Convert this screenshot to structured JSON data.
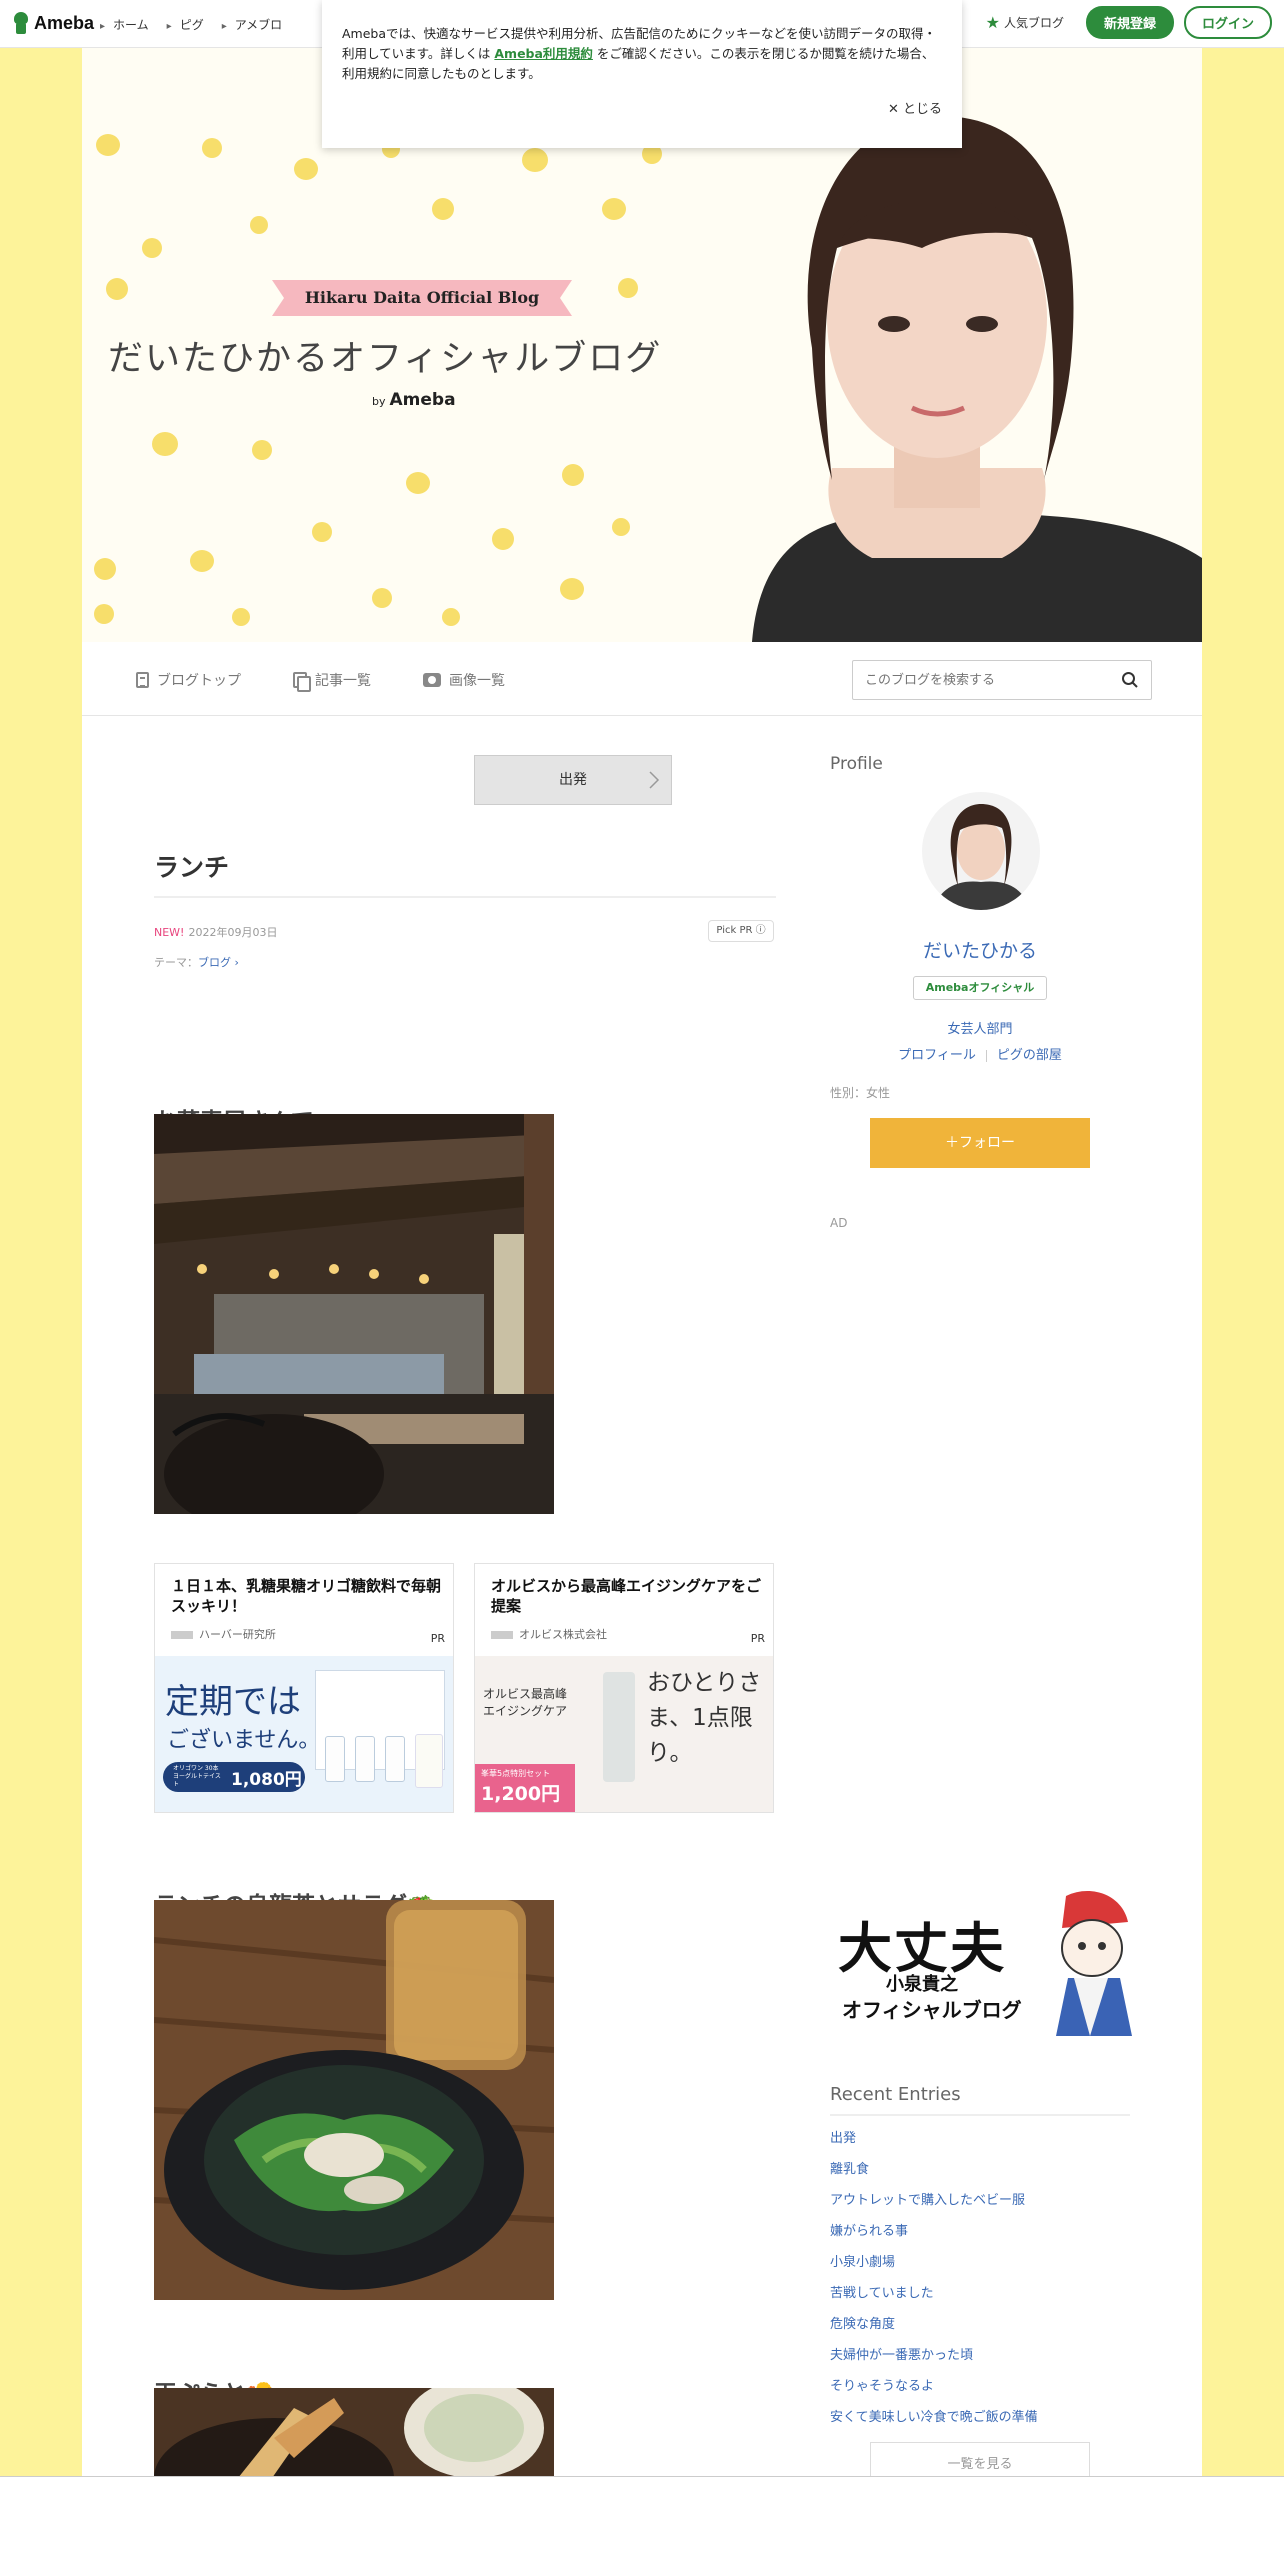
{
  "topbar": {
    "logo": "Ameba",
    "nav": [
      "ホーム",
      "ピグ",
      "アメブロ"
    ],
    "popular": "人気ブログ",
    "signup": "新規登録",
    "login": "ログイン"
  },
  "cookie": {
    "text1": "Amebaでは、快適なサービス提供や利用分析、広告配信のためにクッキーなどを使い訪問データの取得・利用しています。詳しくは",
    "link": "Ameba利用規約",
    "text2": "をご確認ください。この表示を閉じるか閲覧を続けた場合、利用規約に同意したものとします。",
    "close": "✕ とじる"
  },
  "banner": {
    "subtitle": "Hikaru Daita Official Blog",
    "title": "だいたひかるオフィシャルブログ",
    "by": "by",
    "brand": "Ameba"
  },
  "subnav": {
    "top": "ブログトップ",
    "list": "記事一覧",
    "images": "画像一覧",
    "search_placeholder": "このブログを検索する"
  },
  "post": {
    "prev": "出発",
    "title": "ランチ",
    "new": "NEW!",
    "date": "2022年09月03日",
    "pickpr": "Pick PR ⓘ",
    "theme_label": "テーマ：",
    "theme": "ブログ ›",
    "section1": "お蕎麦屋さんで…",
    "section2": "ランチの烏龍茶とサラダ🥗",
    "section3": "天ぷらと🍤"
  },
  "ads": [
    {
      "title": "１日１本、乳糖果糖オリゴ糖飲料で毎朝スッキリ！",
      "sponsor": "ハーバー研究所",
      "pr": "PR",
      "img_big": "定期では",
      "img_small": "ございません。",
      "price": "1,080円",
      "tag": "オリゴワン 30本 ヨーグルトテイスト"
    },
    {
      "title": "オルビスから最高峰エイジングケアをご提案",
      "sponsor": "オルビス株式会社",
      "pr": "PR",
      "img_left": "オルビス最高峰エイジングケア",
      "img_right": "おひとりさま、1点限り。",
      "price": "1,200円",
      "tag": "峯華5点特別セット"
    }
  ],
  "sidebar": {
    "profile_h": "Profile",
    "name": "だいたひかる",
    "badge": "Amebaオフィシャル",
    "category": "女芸人部門",
    "link1": "プロフィール",
    "link2": "ピグの部屋",
    "gender": "性別：女性",
    "follow": "＋フォロー",
    "ad": "AD",
    "banner_big": "大丈夫",
    "banner_small": "小泉貴之",
    "banner_sub": "オフィシャルブログ",
    "recent_h": "Recent Entries",
    "recent": [
      "出発",
      "離乳食",
      "アウトレットで購入したベビー服",
      "嫌がられる事",
      "小泉小劇場",
      "苦戦していました",
      "危険な角度",
      "夫婦仲が一番悪かった頃",
      "そりゃそうなるよ",
      "安くて美味しい冷食で晩ご飯の準備"
    ],
    "more": "一覧を見る"
  },
  "colors": {
    "ameba_green": "#2d8c3c",
    "follow": "#f0b43a",
    "link": "#3b6ab5",
    "page_bg": "#fdf39a"
  }
}
